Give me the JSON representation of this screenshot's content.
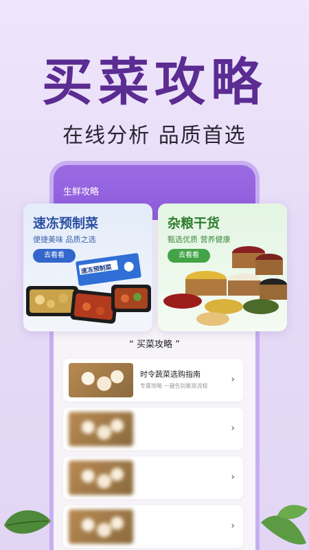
{
  "hero": {
    "title": "买菜攻略",
    "subtitle": "在线分析 品质首选"
  },
  "app": {
    "header_title": "生鲜攻略",
    "accent": "#8e5cdc"
  },
  "cards": [
    {
      "title": "速冻预制菜",
      "subtitle": "便捷美味 品质之选",
      "button": "去看看",
      "package_label": "速冻预制菜",
      "color": "#2a4fa2"
    },
    {
      "title": "杂粮干货",
      "subtitle": "甄选优质 营养健康",
      "button": "去看看",
      "color": "#2e7d2e"
    }
  ],
  "section": {
    "title": "“ 买菜攻略 ”"
  },
  "articles": [
    {
      "title": "时令蔬菜选购指南",
      "subtitle": "专属攻略 一键告别繁琐流程"
    },
    {
      "title": "",
      "subtitle": ""
    },
    {
      "title": "",
      "subtitle": ""
    },
    {
      "title": "",
      "subtitle": ""
    }
  ],
  "icons": {
    "chevron": "›"
  }
}
